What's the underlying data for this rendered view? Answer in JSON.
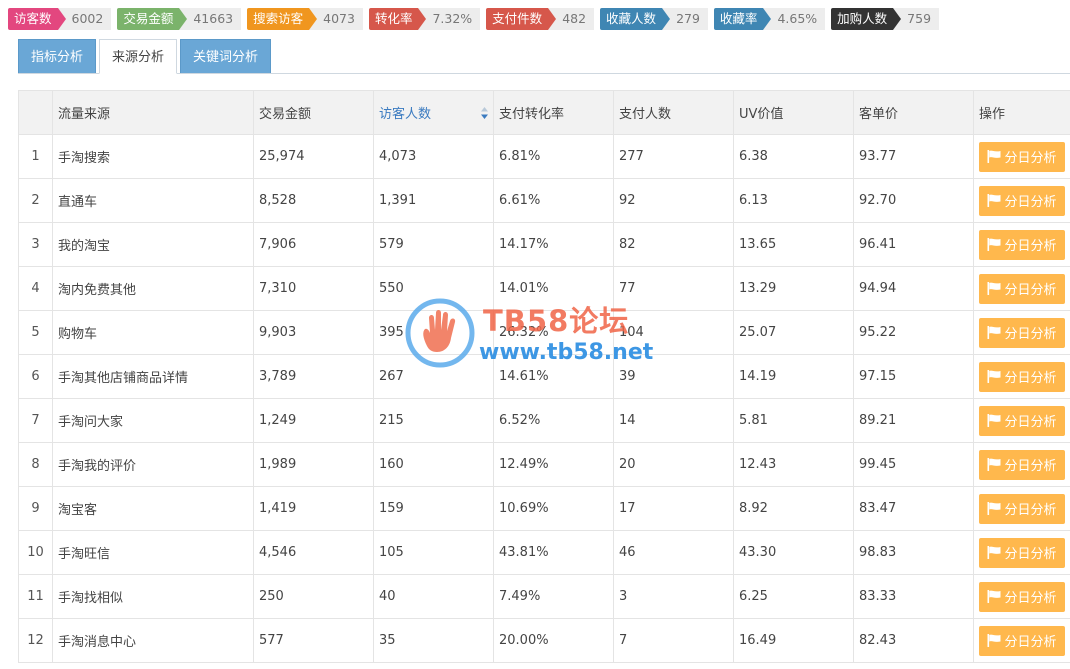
{
  "metrics": [
    {
      "label": "访客数",
      "value": "6002",
      "color": "#e3477f"
    },
    {
      "label": "交易金额",
      "value": "41663",
      "color": "#7bb36b"
    },
    {
      "label": "搜索访客",
      "value": "4073",
      "color": "#f0961f"
    },
    {
      "label": "转化率",
      "value": "7.32%",
      "color": "#d6574b"
    },
    {
      "label": "支付件数",
      "value": "482",
      "color": "#d6574b"
    },
    {
      "label": "收藏人数",
      "value": "279",
      "color": "#3f86b3"
    },
    {
      "label": "收藏率",
      "value": "4.65%",
      "color": "#3f86b3"
    },
    {
      "label": "加购人数",
      "value": "759",
      "color": "#333333"
    }
  ],
  "tabs": [
    {
      "label": "指标分析",
      "active": false
    },
    {
      "label": "来源分析",
      "active": true
    },
    {
      "label": "关键词分析",
      "active": false
    }
  ],
  "table": {
    "columns": [
      "",
      "流量来源",
      "交易金额",
      "访客人数",
      "支付转化率",
      "支付人数",
      "UV价值",
      "客单价",
      "操作"
    ],
    "sorted_column": 3,
    "action_label": "分日分析",
    "rows": [
      [
        "1",
        "手淘搜索",
        "25,974",
        "4,073",
        "6.81%",
        "277",
        "6.38",
        "93.77"
      ],
      [
        "2",
        "直通车",
        "8,528",
        "1,391",
        "6.61%",
        "92",
        "6.13",
        "92.70"
      ],
      [
        "3",
        "我的淘宝",
        "7,906",
        "579",
        "14.17%",
        "82",
        "13.65",
        "96.41"
      ],
      [
        "4",
        "淘内免费其他",
        "7,310",
        "550",
        "14.01%",
        "77",
        "13.29",
        "94.94"
      ],
      [
        "5",
        "购物车",
        "9,903",
        "395",
        "26.32%",
        "104",
        "25.07",
        "95.22"
      ],
      [
        "6",
        "手淘其他店铺商品详情",
        "3,789",
        "267",
        "14.61%",
        "39",
        "14.19",
        "97.15"
      ],
      [
        "7",
        "手淘问大家",
        "1,249",
        "215",
        "6.52%",
        "14",
        "5.81",
        "89.21"
      ],
      [
        "8",
        "手淘我的评价",
        "1,989",
        "160",
        "12.49%",
        "20",
        "12.43",
        "99.45"
      ],
      [
        "9",
        "淘宝客",
        "1,419",
        "159",
        "10.69%",
        "17",
        "8.92",
        "83.47"
      ],
      [
        "10",
        "手淘旺信",
        "4,546",
        "105",
        "43.81%",
        "46",
        "43.30",
        "98.83"
      ],
      [
        "11",
        "手淘找相似",
        "250",
        "40",
        "7.49%",
        "3",
        "6.25",
        "83.33"
      ],
      [
        "12",
        "手淘消息中心",
        "577",
        "35",
        "20.00%",
        "7",
        "16.49",
        "82.43"
      ]
    ]
  },
  "watermark": {
    "title": "TB58论坛",
    "url": "www.tb58.net"
  }
}
